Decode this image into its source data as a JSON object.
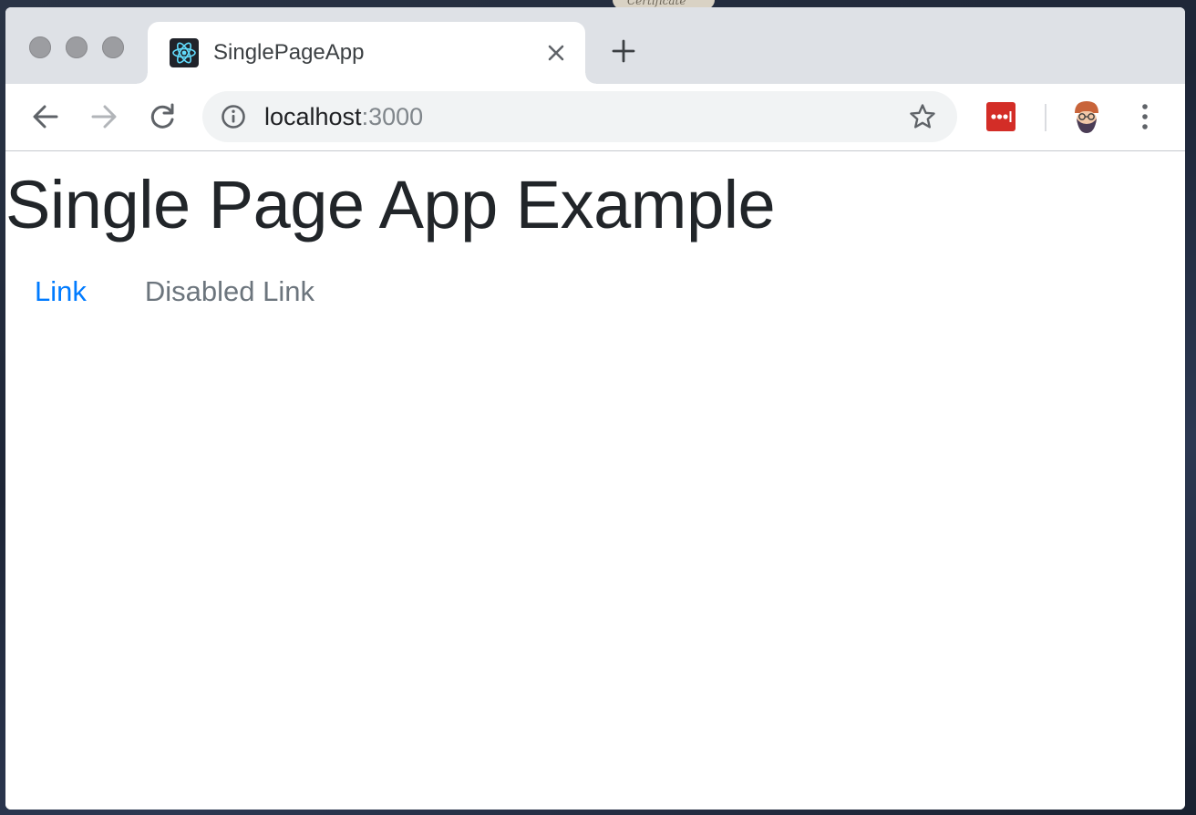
{
  "browser": {
    "tab": {
      "title": "SinglePageApp",
      "favicon": "react-logo-icon",
      "close_icon": "close-icon"
    },
    "new_tab_icon": "plus-icon",
    "toolbar": {
      "back_icon": "back-arrow-icon",
      "forward_icon": "forward-arrow-icon",
      "reload_icon": "reload-icon",
      "address": {
        "host": "localhost",
        "port": ":3000",
        "info_icon": "info-icon",
        "bookmark_icon": "star-icon"
      },
      "extension_icon": "lastpass-icon",
      "profile_icon": "avatar-icon",
      "menu_icon": "more-vertical-icon"
    }
  },
  "page": {
    "heading": "Single Page App Example",
    "nav": {
      "link_label": "Link",
      "disabled_link_label": "Disabled Link"
    }
  },
  "colors": {
    "link": "#007bff",
    "disabled_link": "#6c757d",
    "heading": "#212529",
    "lastpass_red": "#d32d27",
    "react_cyan": "#61dafb"
  }
}
